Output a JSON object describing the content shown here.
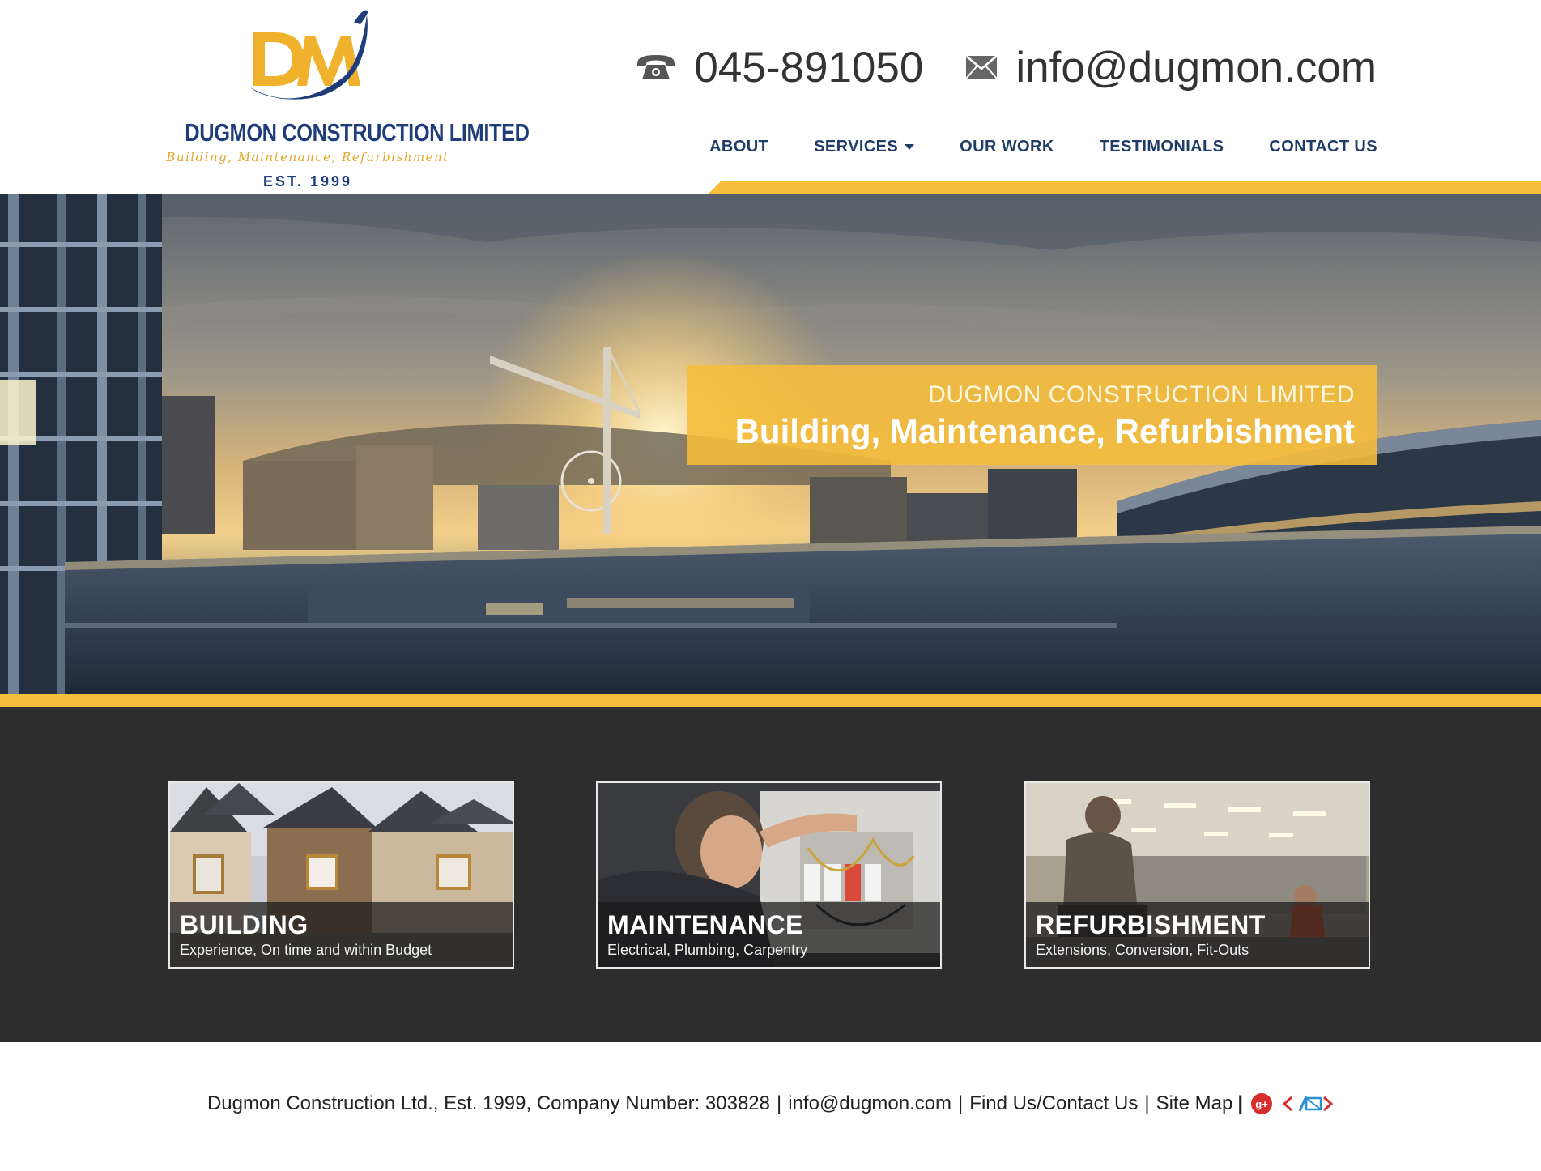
{
  "logo": {
    "name": "DUGMON CONSTRUCTION LIMITED",
    "tagline": "Building, Maintenance, Refurbishment",
    "est": "EST. 1999",
    "monogram": "DM"
  },
  "contact": {
    "phone": "045-891050",
    "email": "info@dugmon.com",
    "phone_icon": "phone-icon",
    "email_icon": "envelope-icon"
  },
  "nav": {
    "about": "ABOUT",
    "services": "SERVICES",
    "our_work": "OUR WORK",
    "testimonials": "TESTIMONIALS",
    "contact_us": "CONTACT US"
  },
  "hero": {
    "kicker": "DUGMON CONSTRUCTION LIMITED",
    "title": "Building, Maintenance, Refurbishment"
  },
  "services": [
    {
      "title": "BUILDING",
      "subtitle": "Experience, On time and within Budget"
    },
    {
      "title": "MAINTENANCE",
      "subtitle": "Electrical, Plumbing, Carpentry"
    },
    {
      "title": "REFURBISHMENT",
      "subtitle": "Extensions, Conversion, Fit-Outs"
    }
  ],
  "footer": {
    "company": "Dugmon Construction Ltd., Est. 1999, Company Number: 303828",
    "email": "info@dugmon.com",
    "find_us": "Find Us/Contact Us",
    "site_map": "Site Map",
    "gplus_label": "g+",
    "dev_label": "</>"
  },
  "colors": {
    "brand_navy": "#1f3d66",
    "brand_gold": "#f6bd3a",
    "services_bg": "#2d2d2d"
  }
}
